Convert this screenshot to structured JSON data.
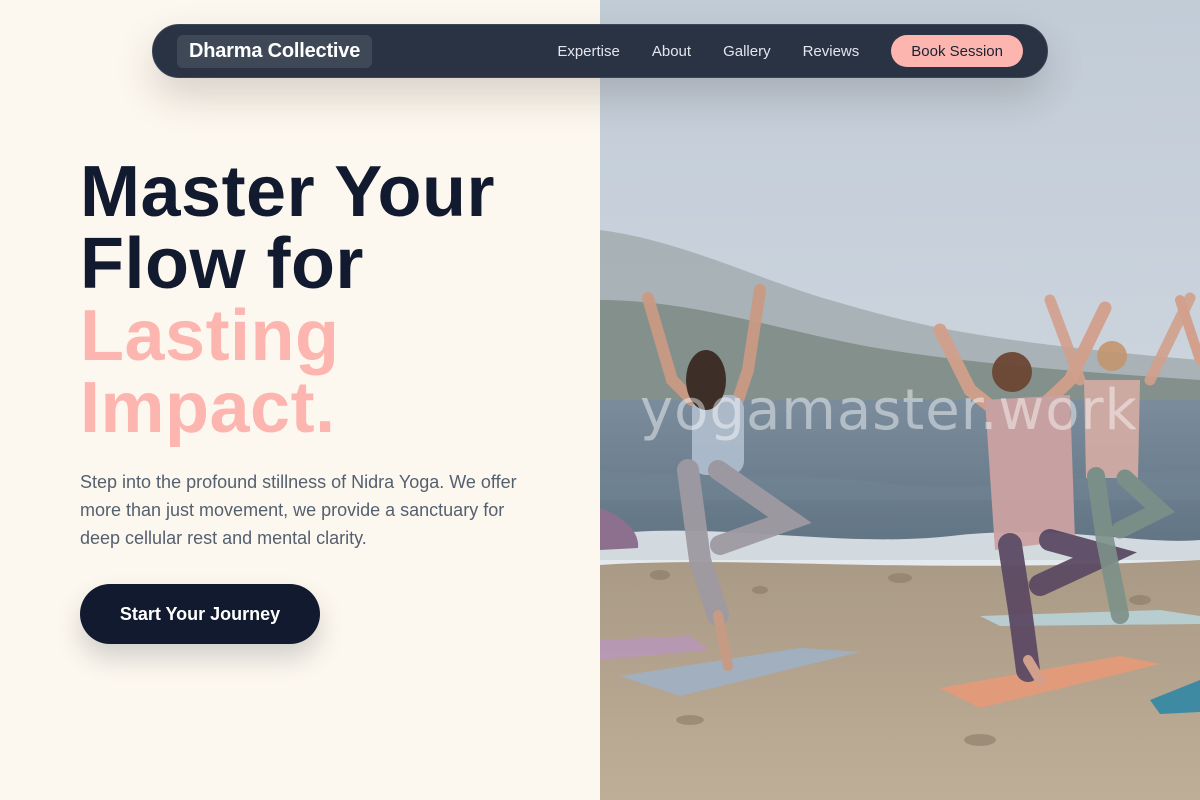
{
  "nav": {
    "brand": "Dharma Collective",
    "links": [
      {
        "label": "Expertise"
      },
      {
        "label": "About"
      },
      {
        "label": "Gallery"
      },
      {
        "label": "Reviews"
      }
    ],
    "cta_label": "Book Session"
  },
  "hero": {
    "headline_line1": "Master Your",
    "headline_line2": "Flow for",
    "headline_accent_line1": "Lasting",
    "headline_accent_line2": "Impact.",
    "subtext": "Step into the profound stillness of Nidra Yoga. We offer more than just movement, we provide a sanctuary for deep cellular rest and mental clarity.",
    "cta_label": "Start Your Journey"
  },
  "image": {
    "watermark": "yogamaster.work"
  },
  "colors": {
    "background": "#fdf8ef",
    "navbar": "#2a3344",
    "accent_pink": "#fdb5b0",
    "headline_dark": "#111a2e",
    "body_text": "#55606f"
  }
}
